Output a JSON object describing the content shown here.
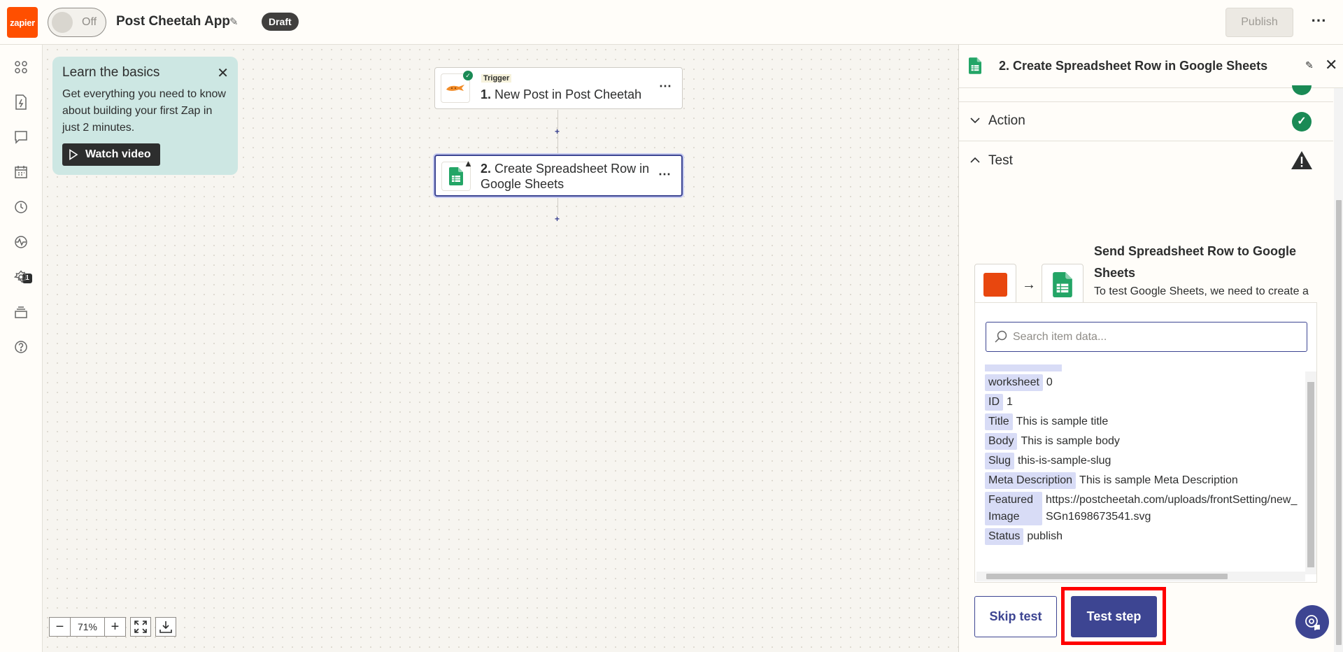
{
  "header": {
    "logo_text": "zapier",
    "toggle_label": "Off",
    "app_title": "Post Cheetah App",
    "status_badge": "Draft",
    "publish_label": "Publish"
  },
  "sidebar": {
    "badge_count": "1",
    "icons": [
      "apps-icon",
      "zap-icon",
      "chat-icon",
      "calendar-icon",
      "history-icon",
      "activity-icon",
      "settings-icon",
      "stack-icon",
      "help-icon"
    ]
  },
  "basics": {
    "title": "Learn the basics",
    "description": "Get everything you need to know about building your first Zap in just 2 minutes.",
    "button_label": "Watch video"
  },
  "steps": [
    {
      "tag": "Trigger",
      "number": "1.",
      "label": "New Post in Post Cheetah",
      "status": "ok"
    },
    {
      "number": "2.",
      "label": "Create Spreadsheet Row in Google Sheets",
      "status": "warning"
    }
  ],
  "zoom": {
    "value": "71%"
  },
  "panel": {
    "title": "2. Create Spreadsheet Row in Google Sheets",
    "sections": {
      "action": "Action",
      "test": "Test"
    },
    "send_title": "Send Spreadsheet Row to Google Sheets",
    "send_desc": "To test Google Sheets, we need to create a new spreadsheet row. This is what will be created:",
    "search_placeholder": "Search item data...",
    "data_rows": [
      {
        "key": "worksheet",
        "value": "0"
      },
      {
        "key": "ID",
        "value": "1"
      },
      {
        "key": "Title",
        "value": "This is sample title"
      },
      {
        "key": "Body",
        "value": "This is sample body"
      },
      {
        "key": "Slug",
        "value": "this-is-sample-slug"
      },
      {
        "key": "Meta Description",
        "value": "This is sample Meta Description"
      },
      {
        "key": "Featured Image",
        "value": "https://postcheetah.com/uploads/frontSetting/new_SGn1698673541.svg"
      },
      {
        "key": "Status",
        "value": "publish"
      }
    ],
    "skip_label": "Skip test",
    "test_label": "Test step"
  },
  "colors": {
    "brand": "#ff4f00",
    "accent": "#3d4592",
    "success": "#1a8a55",
    "highlight": "#ff0000"
  }
}
